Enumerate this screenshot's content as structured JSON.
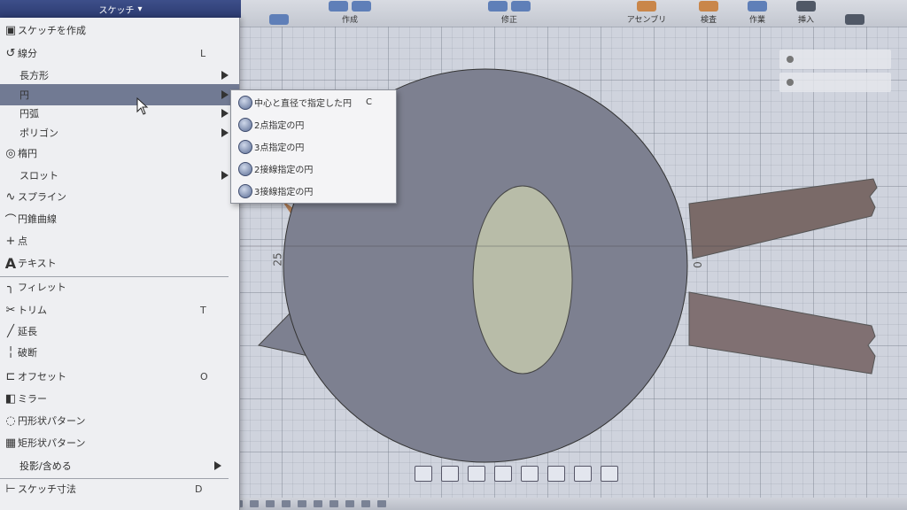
{
  "toolbar": {
    "groups": [
      {
        "label": "作成"
      },
      {
        "label": "修正"
      },
      {
        "label": "アセンブリ"
      },
      {
        "label": "検査"
      },
      {
        "label": "作業"
      },
      {
        "label": "挿入"
      }
    ]
  },
  "sketch_menu": {
    "title": "スケッチ",
    "items": [
      {
        "label": "スケッチを作成",
        "icon": "sketch-create-icon"
      },
      {
        "label": "線分",
        "key": "L",
        "icon": "line-icon"
      },
      {
        "label": "長方形",
        "icon": "",
        "has_submenu": true
      },
      {
        "label": "円",
        "icon": "",
        "has_submenu": true,
        "active": true
      },
      {
        "label": "円弧",
        "icon": "",
        "has_submenu": true
      },
      {
        "label": "ポリゴン",
        "icon": "",
        "has_submenu": true
      },
      {
        "label": "楕円",
        "icon": "ellipse-icon"
      },
      {
        "label": "スロット",
        "icon": "",
        "has_submenu": true
      },
      {
        "label": "スプライン",
        "icon": "spline-icon"
      },
      {
        "label": "円錐曲線",
        "icon": "conic-icon"
      },
      {
        "label": "点",
        "icon": "point-icon"
      },
      {
        "label": "テキスト",
        "icon": "text-icon"
      },
      {
        "label": "フィレット",
        "icon": "fillet-icon"
      },
      {
        "label": "トリム",
        "key": "T",
        "icon": "trim-icon"
      },
      {
        "label": "延長",
        "icon": "extend-icon"
      },
      {
        "label": "破断",
        "icon": "break-icon"
      },
      {
        "label": "オフセット",
        "key": "O",
        "icon": "offset-icon"
      },
      {
        "label": "ミラー",
        "icon": "mirror-icon"
      },
      {
        "label": "円形状パターン",
        "icon": "circular-pattern-icon"
      },
      {
        "label": "矩形状パターン",
        "icon": "rectangular-pattern-icon"
      },
      {
        "label": "投影/含める",
        "icon": "",
        "has_submenu": true
      },
      {
        "label": "スケッチ寸法",
        "key": "D",
        "icon": "sketch-dimension-icon"
      }
    ]
  },
  "circle_submenu": {
    "items": [
      {
        "label": "中心と直径で指定した円",
        "key": "C"
      },
      {
        "label": "2点指定の円"
      },
      {
        "label": "3点指定の円"
      },
      {
        "label": "2接線指定の円"
      },
      {
        "label": "3接線指定の円"
      }
    ]
  },
  "canvas": {
    "axis_labels": [
      "25",
      "0"
    ]
  },
  "colors": {
    "menu_header": "#2c3b70",
    "active_item": "#717a93",
    "sketch_fill": "#7d8090"
  }
}
